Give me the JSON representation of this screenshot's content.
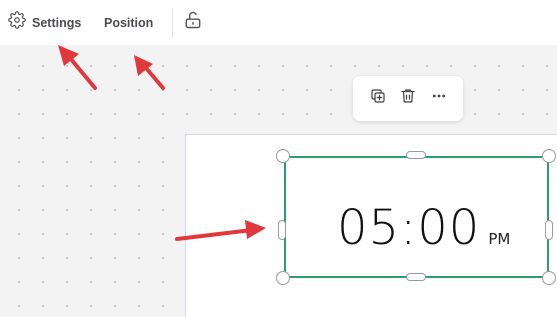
{
  "toolbar": {
    "settings_label": "Settings",
    "position_label": "Position",
    "settings_icon": "gear-icon",
    "lock_icon": "unlock-icon"
  },
  "floating_toolbar": {
    "icons": [
      "duplicate-icon",
      "trash-icon",
      "more-icon"
    ],
    "more_label": "···"
  },
  "clock": {
    "time": "05:00",
    "ampm": "PM"
  },
  "colors": {
    "selection": "#27a06c",
    "annotation_arrow": "#e0383b"
  }
}
